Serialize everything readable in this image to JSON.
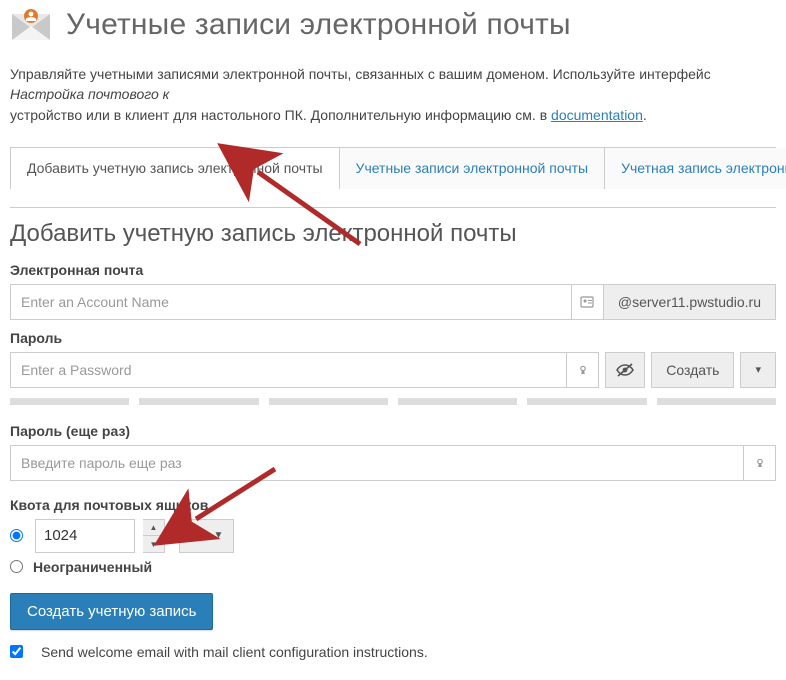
{
  "header": {
    "title": "Учетные записи электронной почты"
  },
  "intro": {
    "part1": "Управляйте учетными записями электронной почты, связанных с вашим доменом. Используйте интерфейс ",
    "em": "Настройка почтового к",
    "part2": " устройство или в клиент для настольного ПК. Дополнительную информацию см. в ",
    "link": "documentation",
    "part3": "."
  },
  "tabs": {
    "add": "Добавить учетную запись электронной почты",
    "list": "Учетные записи электронной почты",
    "default": "Учетная запись электронной почты по"
  },
  "section": {
    "title": "Добавить учетную запись электронной почты"
  },
  "email": {
    "label": "Электронная почта",
    "placeholder": "Enter an Account Name",
    "domain": "@server11.pwstudio.ru"
  },
  "password": {
    "label": "Пароль",
    "placeholder": "Enter a Password",
    "generate_btn": "Создать"
  },
  "password_confirm": {
    "label": "Пароль (еще раз)",
    "placeholder": "Введите пароль еще раз"
  },
  "quota": {
    "label": "Квота для почтовых ящиков",
    "value": "1024",
    "unit": "MB",
    "unlimited": "Неограниченный"
  },
  "actions": {
    "create": "Создать учетную запись"
  },
  "welcome": {
    "text": "Send welcome email with mail client configuration instructions."
  }
}
